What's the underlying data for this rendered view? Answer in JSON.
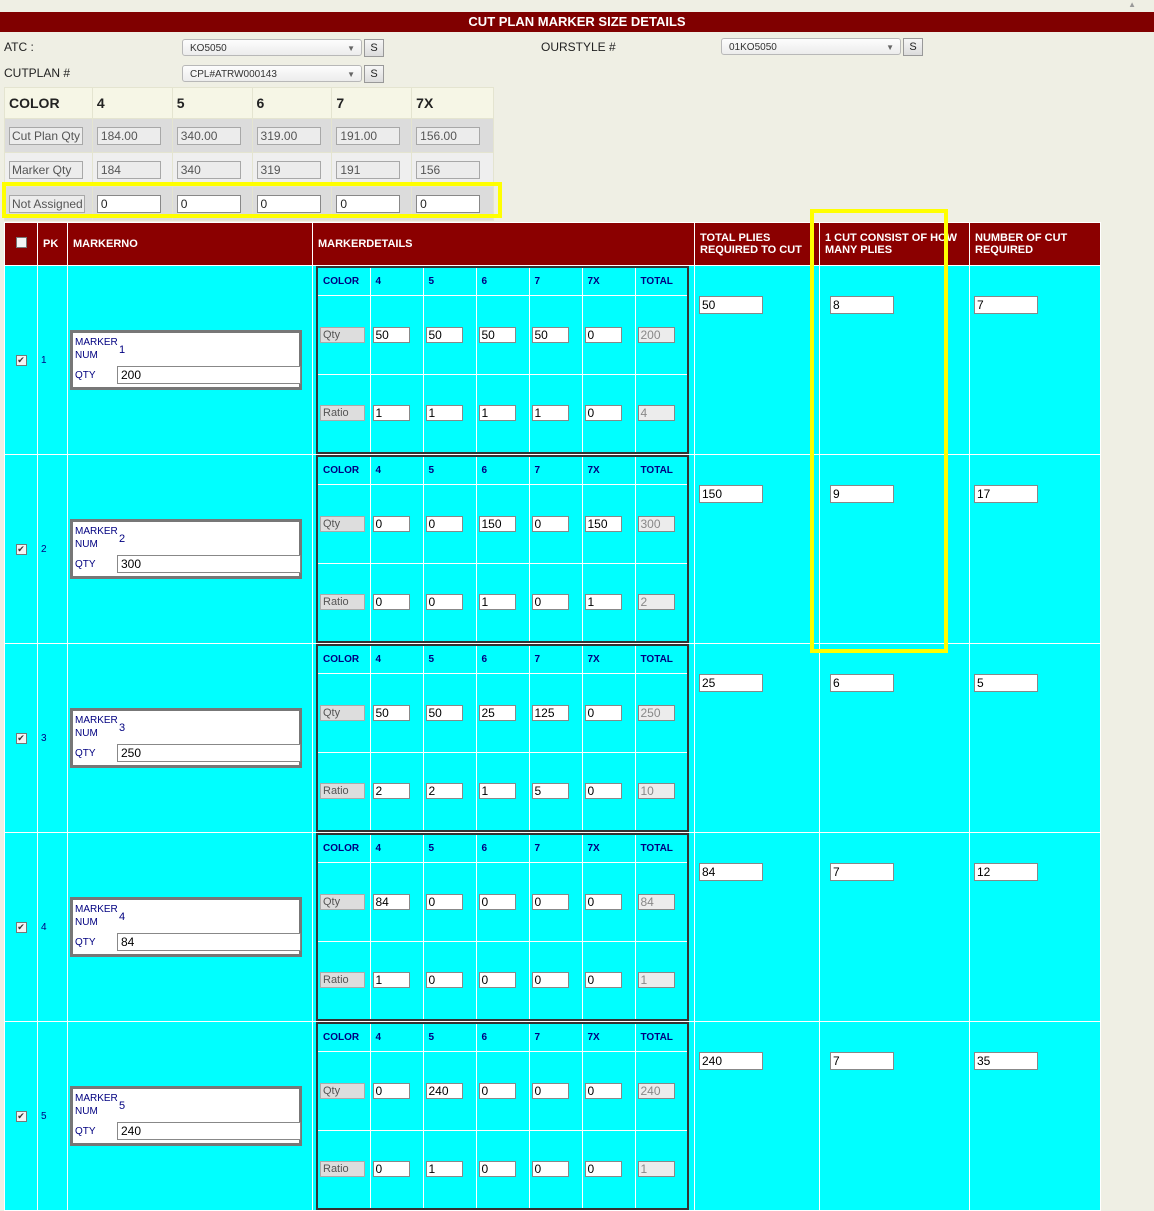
{
  "title": "CUT PLAN MARKER SIZE DETAILS",
  "filters": {
    "atc_label": "ATC :",
    "atc_value": "KO5050",
    "ourstyle_label": "OURSTYLE #",
    "ourstyle_value": "01KO5050",
    "cutplan_label": "CUTPLAN #",
    "cutplan_value": "CPL#ATRW000143",
    "search_label": "S"
  },
  "size_table": {
    "header": "COLOR",
    "sizes": [
      "4",
      "5",
      "6",
      "7",
      "7X"
    ],
    "rows": [
      {
        "label": "Cut Plan Qty",
        "values": [
          "184.00",
          "340.00",
          "319.00",
          "191.00",
          "156.00"
        ]
      },
      {
        "label": "Marker Qty",
        "values": [
          "184",
          "340",
          "319",
          "191",
          "156"
        ]
      },
      {
        "label": "Not Assigned",
        "values": [
          "0",
          "0",
          "0",
          "0",
          "0"
        ]
      }
    ]
  },
  "grid": {
    "headers": {
      "pk": "PK",
      "markerno": "MARKERNO",
      "markerdetails": "MARKERDETAILS",
      "total_plies": "TOTAL PLIES REQUIRED TO CUT",
      "one_cut": "1 CUT CONSIST OF HOW MANY PLIES",
      "num_cut": "NUMBER OF CUT REQUIRED"
    },
    "marker_labels": {
      "marker": "MARKER",
      "num": "NUM",
      "qty": "QTY"
    },
    "detail_labels": {
      "color": "COLOR",
      "total": "TOTAL",
      "qty": "Qty",
      "ratio": "Ratio"
    },
    "check_mark": "✔",
    "rows": [
      {
        "pk": "1",
        "marker_num": "1",
        "qty": "200",
        "qtys": [
          "50",
          "50",
          "50",
          "50",
          "0"
        ],
        "qty_total": "200",
        "ratios": [
          "1",
          "1",
          "1",
          "1",
          "0"
        ],
        "ratio_total": "4",
        "total_plies": "50",
        "one_cut": "8",
        "num_cut": "7"
      },
      {
        "pk": "2",
        "marker_num": "2",
        "qty": "300",
        "qtys": [
          "0",
          "0",
          "150",
          "0",
          "150"
        ],
        "qty_total": "300",
        "ratios": [
          "0",
          "0",
          "1",
          "0",
          "1"
        ],
        "ratio_total": "2",
        "total_plies": "150",
        "one_cut": "9",
        "num_cut": "17"
      },
      {
        "pk": "3",
        "marker_num": "3",
        "qty": "250",
        "qtys": [
          "50",
          "50",
          "25",
          "125",
          "0"
        ],
        "qty_total": "250",
        "ratios": [
          "2",
          "2",
          "1",
          "5",
          "0"
        ],
        "ratio_total": "10",
        "total_plies": "25",
        "one_cut": "6",
        "num_cut": "5"
      },
      {
        "pk": "4",
        "marker_num": "4",
        "qty": "84",
        "qtys": [
          "84",
          "0",
          "0",
          "0",
          "0"
        ],
        "qty_total": "84",
        "ratios": [
          "1",
          "0",
          "0",
          "0",
          "0"
        ],
        "ratio_total": "1",
        "total_plies": "84",
        "one_cut": "7",
        "num_cut": "12"
      },
      {
        "pk": "5",
        "marker_num": "5",
        "qty": "240",
        "qtys": [
          "0",
          "240",
          "0",
          "0",
          "0"
        ],
        "qty_total": "240",
        "ratios": [
          "0",
          "1",
          "0",
          "0",
          "0"
        ],
        "ratio_total": "1",
        "total_plies": "240",
        "one_cut": "7",
        "num_cut": "35"
      }
    ]
  },
  "colors": {
    "title_bg": "#800000",
    "row_bg": "#00ffff",
    "detail_bg": "#bccf8a",
    "highlight": "#ffff00"
  }
}
